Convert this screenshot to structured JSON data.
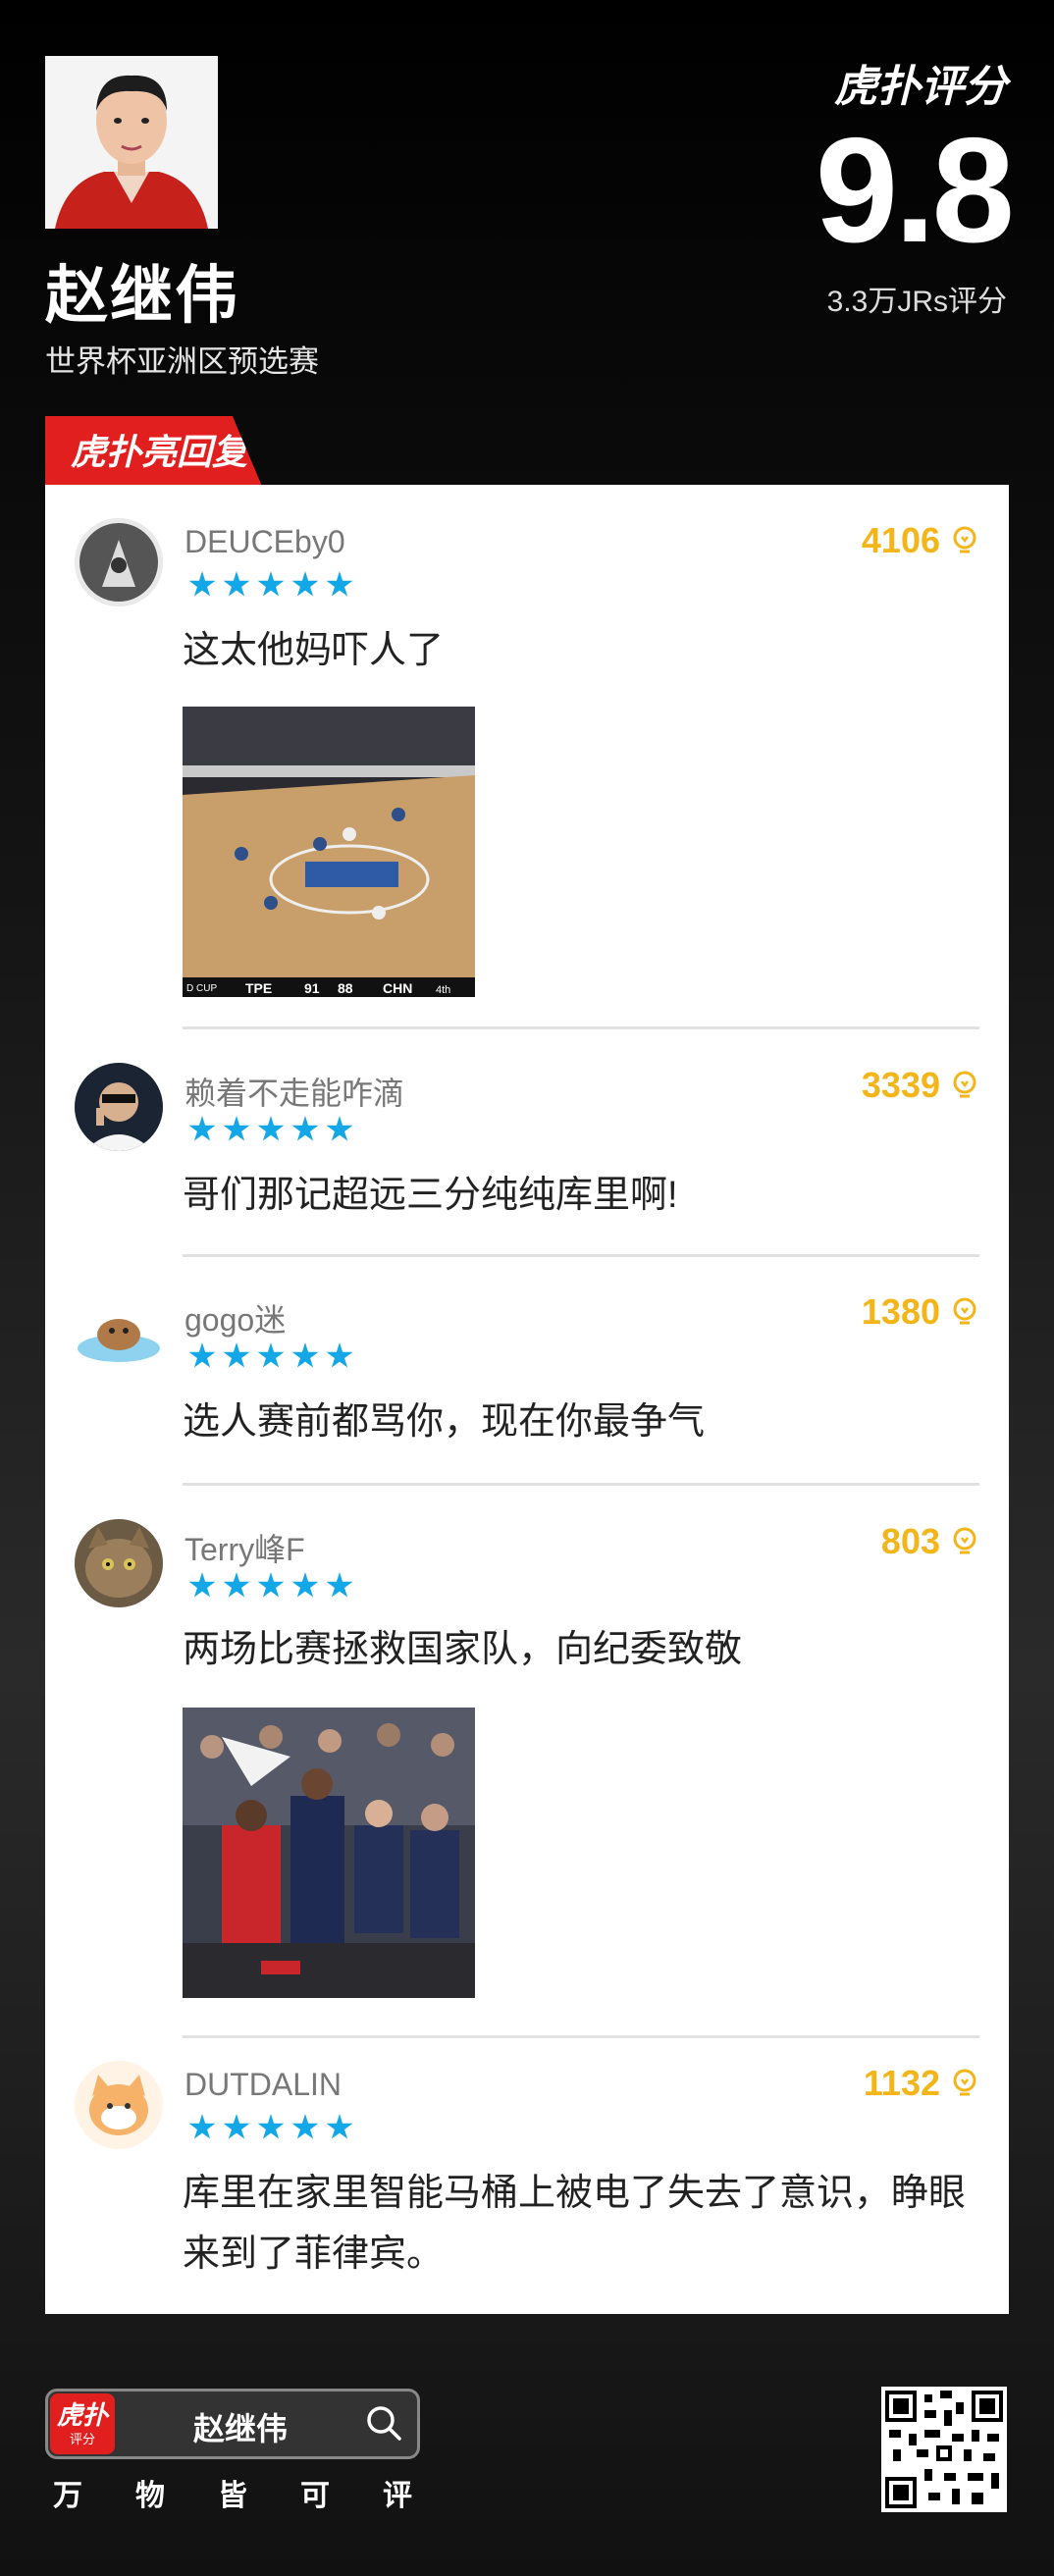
{
  "header": {
    "player_name": "赵继伟",
    "event": "世界杯亚洲区预选赛",
    "brand": "虎扑评分",
    "score": "9.8",
    "rating_count": "3.3万JRs评分"
  },
  "section_tag": "虎扑亮回复",
  "comments": [
    {
      "user": "DEUCEby0",
      "likes": "4106",
      "stars": 5,
      "text": "这太他妈吓人了",
      "image_text": {
        "team1": "TPE",
        "s1": "91",
        "s2": "88",
        "team2": "CHN",
        "q": "4th",
        "cup": "D CUP"
      }
    },
    {
      "user": "赖着不走能咋滴",
      "likes": "3339",
      "stars": 5,
      "text": "哥们那记超远三分纯纯库里啊!"
    },
    {
      "user": "gogo迷",
      "likes": "1380",
      "stars": 5,
      "text": "选人赛前都骂你，现在你最争气"
    },
    {
      "user": "Terry峰F",
      "likes": "803",
      "stars": 5,
      "text": "两场比赛拯救国家队，向纪委致敬"
    },
    {
      "user": "DUTDALIN",
      "likes": "1132",
      "stars": 5,
      "text": "库里在家里智能马桶上被电了失去了意识，睁眼来到了菲律宾。"
    }
  ],
  "footer": {
    "logo": "虎扑",
    "logo_sub": "评分",
    "search_text": "赵继伟",
    "slogan": [
      "万",
      "物",
      "皆",
      "可",
      "评"
    ]
  },
  "colors": {
    "accent_red": "#e21f1f",
    "star_blue": "#13a7e8",
    "likes_gold": "#f2b51a"
  }
}
